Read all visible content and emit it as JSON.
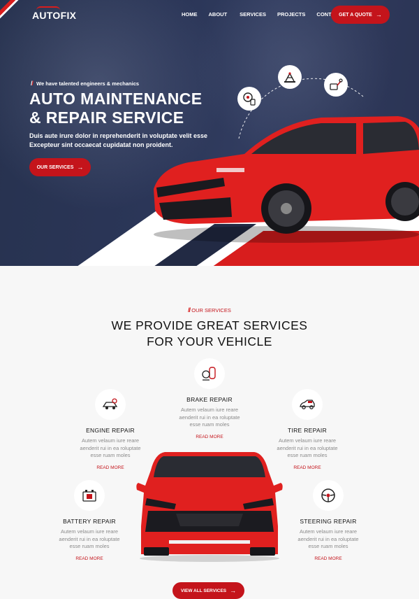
{
  "brand": {
    "name": "AUTOFIX"
  },
  "nav": {
    "items": [
      "HOME",
      "ABOUT",
      "SERVICES",
      "PROJECTS",
      "CONTACT"
    ],
    "cta_label": "GET A QUOTE"
  },
  "hero": {
    "tagline": "We have talented engineers & mechanics",
    "title_line1": "AUTO MAINTENANCE",
    "title_line2": "& REPAIR SERVICE",
    "desc_line1": "Duis aute irure dolor in reprehenderit in voluptate velit esse",
    "desc_line2": "Excepteur sint occaecat cupidatat non proident.",
    "button_label": "OUR SERVICES",
    "icons": [
      "tire-service-icon",
      "car-jack-icon",
      "battery-charge-icon"
    ]
  },
  "services": {
    "label": "OUR SERVICES",
    "title_line1": "WE PROVIDE GREAT SERVICES",
    "title_line2": "FOR YOUR VEHICLE",
    "desc_line1": "Autem velaum iure reare",
    "desc_line2": "aenderit rui in ea roluptate",
    "desc_line3": "esse ruam moles",
    "read_more": "READ MORE",
    "items": [
      {
        "name": "BRAKE REPAIR",
        "icon": "brake-icon"
      },
      {
        "name": "ENGINE REPAIR",
        "icon": "engine-icon"
      },
      {
        "name": "TIRE REPAIR",
        "icon": "car-tire-icon"
      },
      {
        "name": "BATTERY REPAIR",
        "icon": "battery-icon"
      },
      {
        "name": "STEERING REPAIR",
        "icon": "steering-wheel-icon"
      }
    ],
    "view_all_label": "VIEW ALL SERVICES"
  },
  "colors": {
    "accent": "#c4141b",
    "hero_bg": "#2b3658",
    "car_red": "#e0201f"
  }
}
